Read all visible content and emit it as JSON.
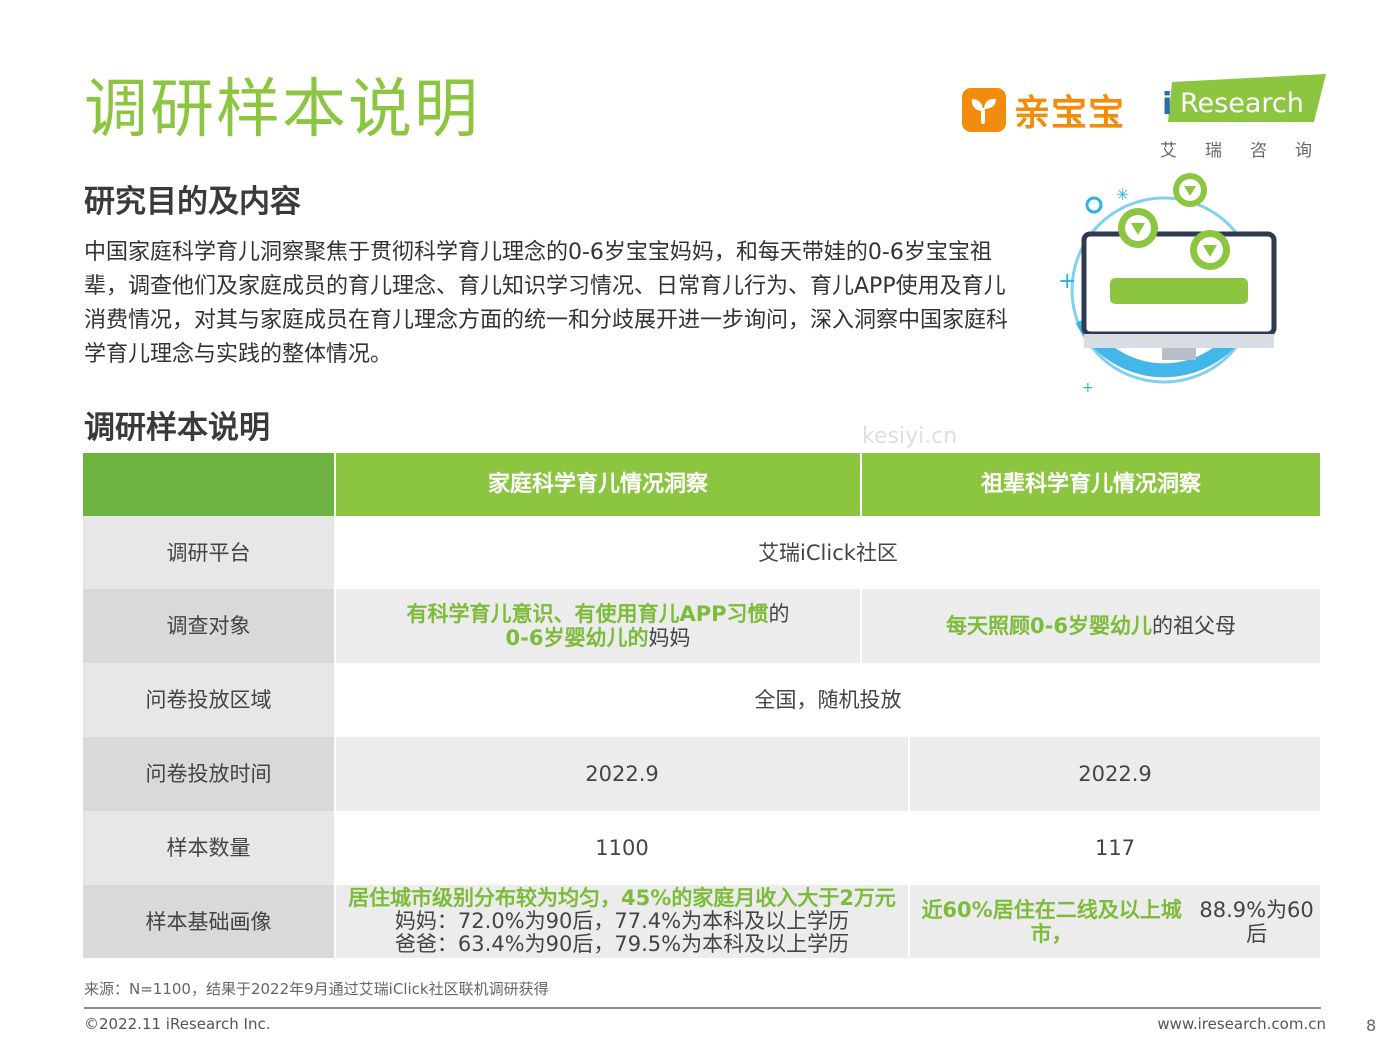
{
  "title": "调研样本说明",
  "logos": {
    "qinbaobao": "亲宝宝",
    "iresearch": "iResearch",
    "iresearch_cn": "艾瑞咨询"
  },
  "section1": {
    "heading": "研究目的及内容",
    "paragraph": "中国家庭科学育儿洞察聚焦于贯彻科学育儿理念的0-6岁宝宝妈妈，和每天带娃的0-6岁宝宝祖辈，调查他们及家庭成员的育儿理念、育儿知识学习情况、日常育儿行为、育儿APP使用及育儿消费情况，对其与家庭成员在育儿理念方面的统一和分歧展开进一步询问，深入洞察中国家庭科学育儿理念与实践的整体情况。"
  },
  "section2": {
    "heading": "调研样本说明"
  },
  "table": {
    "header": [
      "",
      "家庭科学育儿情况洞察",
      "祖辈科学育儿情况洞察"
    ],
    "rows": {
      "platform": {
        "label": "调研平台",
        "value": "艾瑞iClick社区"
      },
      "target": {
        "label": "调查对象",
        "a_green1": "有科学育儿意识、有使用育儿APP习惯",
        "a_plain1": "的",
        "a_green2": "0-6岁婴幼儿的",
        "a_plain2": "妈妈",
        "b_green": "每天照顾0-6岁婴幼儿",
        "b_plain": "的祖父母"
      },
      "region": {
        "label": "问卷投放区域",
        "value": "全国，随机投放"
      },
      "time": {
        "label": "问卷投放时间",
        "a": "2022.9",
        "b": "2022.9"
      },
      "count": {
        "label": "样本数量",
        "a": "1100",
        "b": "117"
      },
      "profile": {
        "label": "样本基础画像",
        "a_green": "居住城市级别分布较为均匀，45%的家庭月收入大于2万元",
        "a_line2": "妈妈：72.0%为90后，77.4%为本科及以上学历",
        "a_line3": "爸爸：63.4%为90后，79.5%为本科及以上学历",
        "b_green": "近60%居住在二线及以上城市，",
        "b_plain": "88.9%为60后"
      }
    }
  },
  "source": "来源：N=1100，结果于2022年9月通过艾瑞iClick社区联机调研获得",
  "footer": {
    "copyright": "©2022.11 iResearch Inc.",
    "website": "www.iresearch.com.cn",
    "page": "8"
  },
  "watermark": "kesiyi.cn",
  "colors": {
    "accent_green": "#8cc540",
    "dark_green": "#6cb33f",
    "orange": "#f28c0d",
    "blue": "#2fb0e6"
  }
}
